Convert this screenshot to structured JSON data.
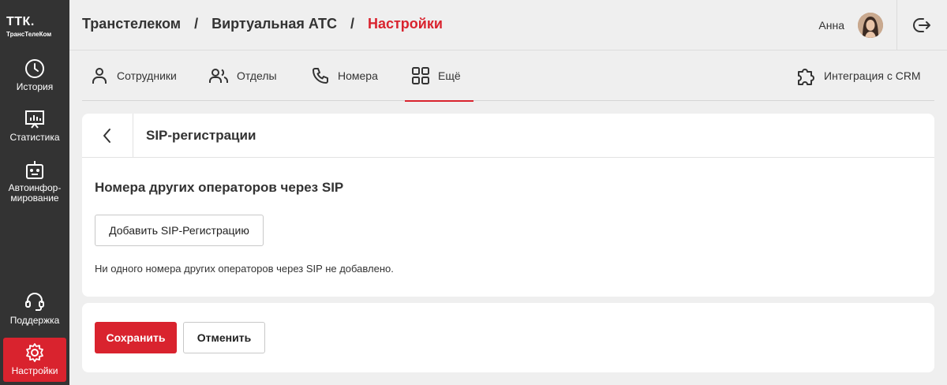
{
  "sidebar": {
    "logo_main": "ТТК.",
    "logo_sub": "ТрансТелеКом",
    "items": [
      {
        "label": "История",
        "icon": "clock-icon"
      },
      {
        "label": "Статистика",
        "icon": "chart-icon"
      },
      {
        "label": "Автоинфор-мирование",
        "label_lines": [
          "Автоинфор-",
          "мирование"
        ],
        "icon": "robot-icon"
      },
      {
        "label": "Поддержка",
        "icon": "headset-icon"
      },
      {
        "label": "Настройки",
        "icon": "gear-icon",
        "active": true
      }
    ]
  },
  "header": {
    "breadcrumb": [
      "Транстелеком",
      "Виртуальная АТС",
      "Настройки"
    ],
    "separator": "/",
    "user_name": "Анна"
  },
  "tabs": [
    {
      "label": "Сотрудники",
      "icon": "user-icon"
    },
    {
      "label": "Отделы",
      "icon": "users-icon"
    },
    {
      "label": "Номера",
      "icon": "phone-icon"
    },
    {
      "label": "Ещё",
      "icon": "grid-icon",
      "active": true
    },
    {
      "label": "Интеграция с CRM",
      "icon": "puzzle-icon"
    }
  ],
  "panel": {
    "title": "SIP-регистрации",
    "section_title": "Номера других операторов через SIP",
    "add_button": "Добавить SIP-Регистрацию",
    "empty_text": "Ни одного номера других операторов через SIP не добавлено."
  },
  "actions": {
    "save": "Сохранить",
    "cancel": "Отменить"
  },
  "colors": {
    "accent": "#d9232e",
    "sidebar": "#333333",
    "background": "#efefef"
  }
}
